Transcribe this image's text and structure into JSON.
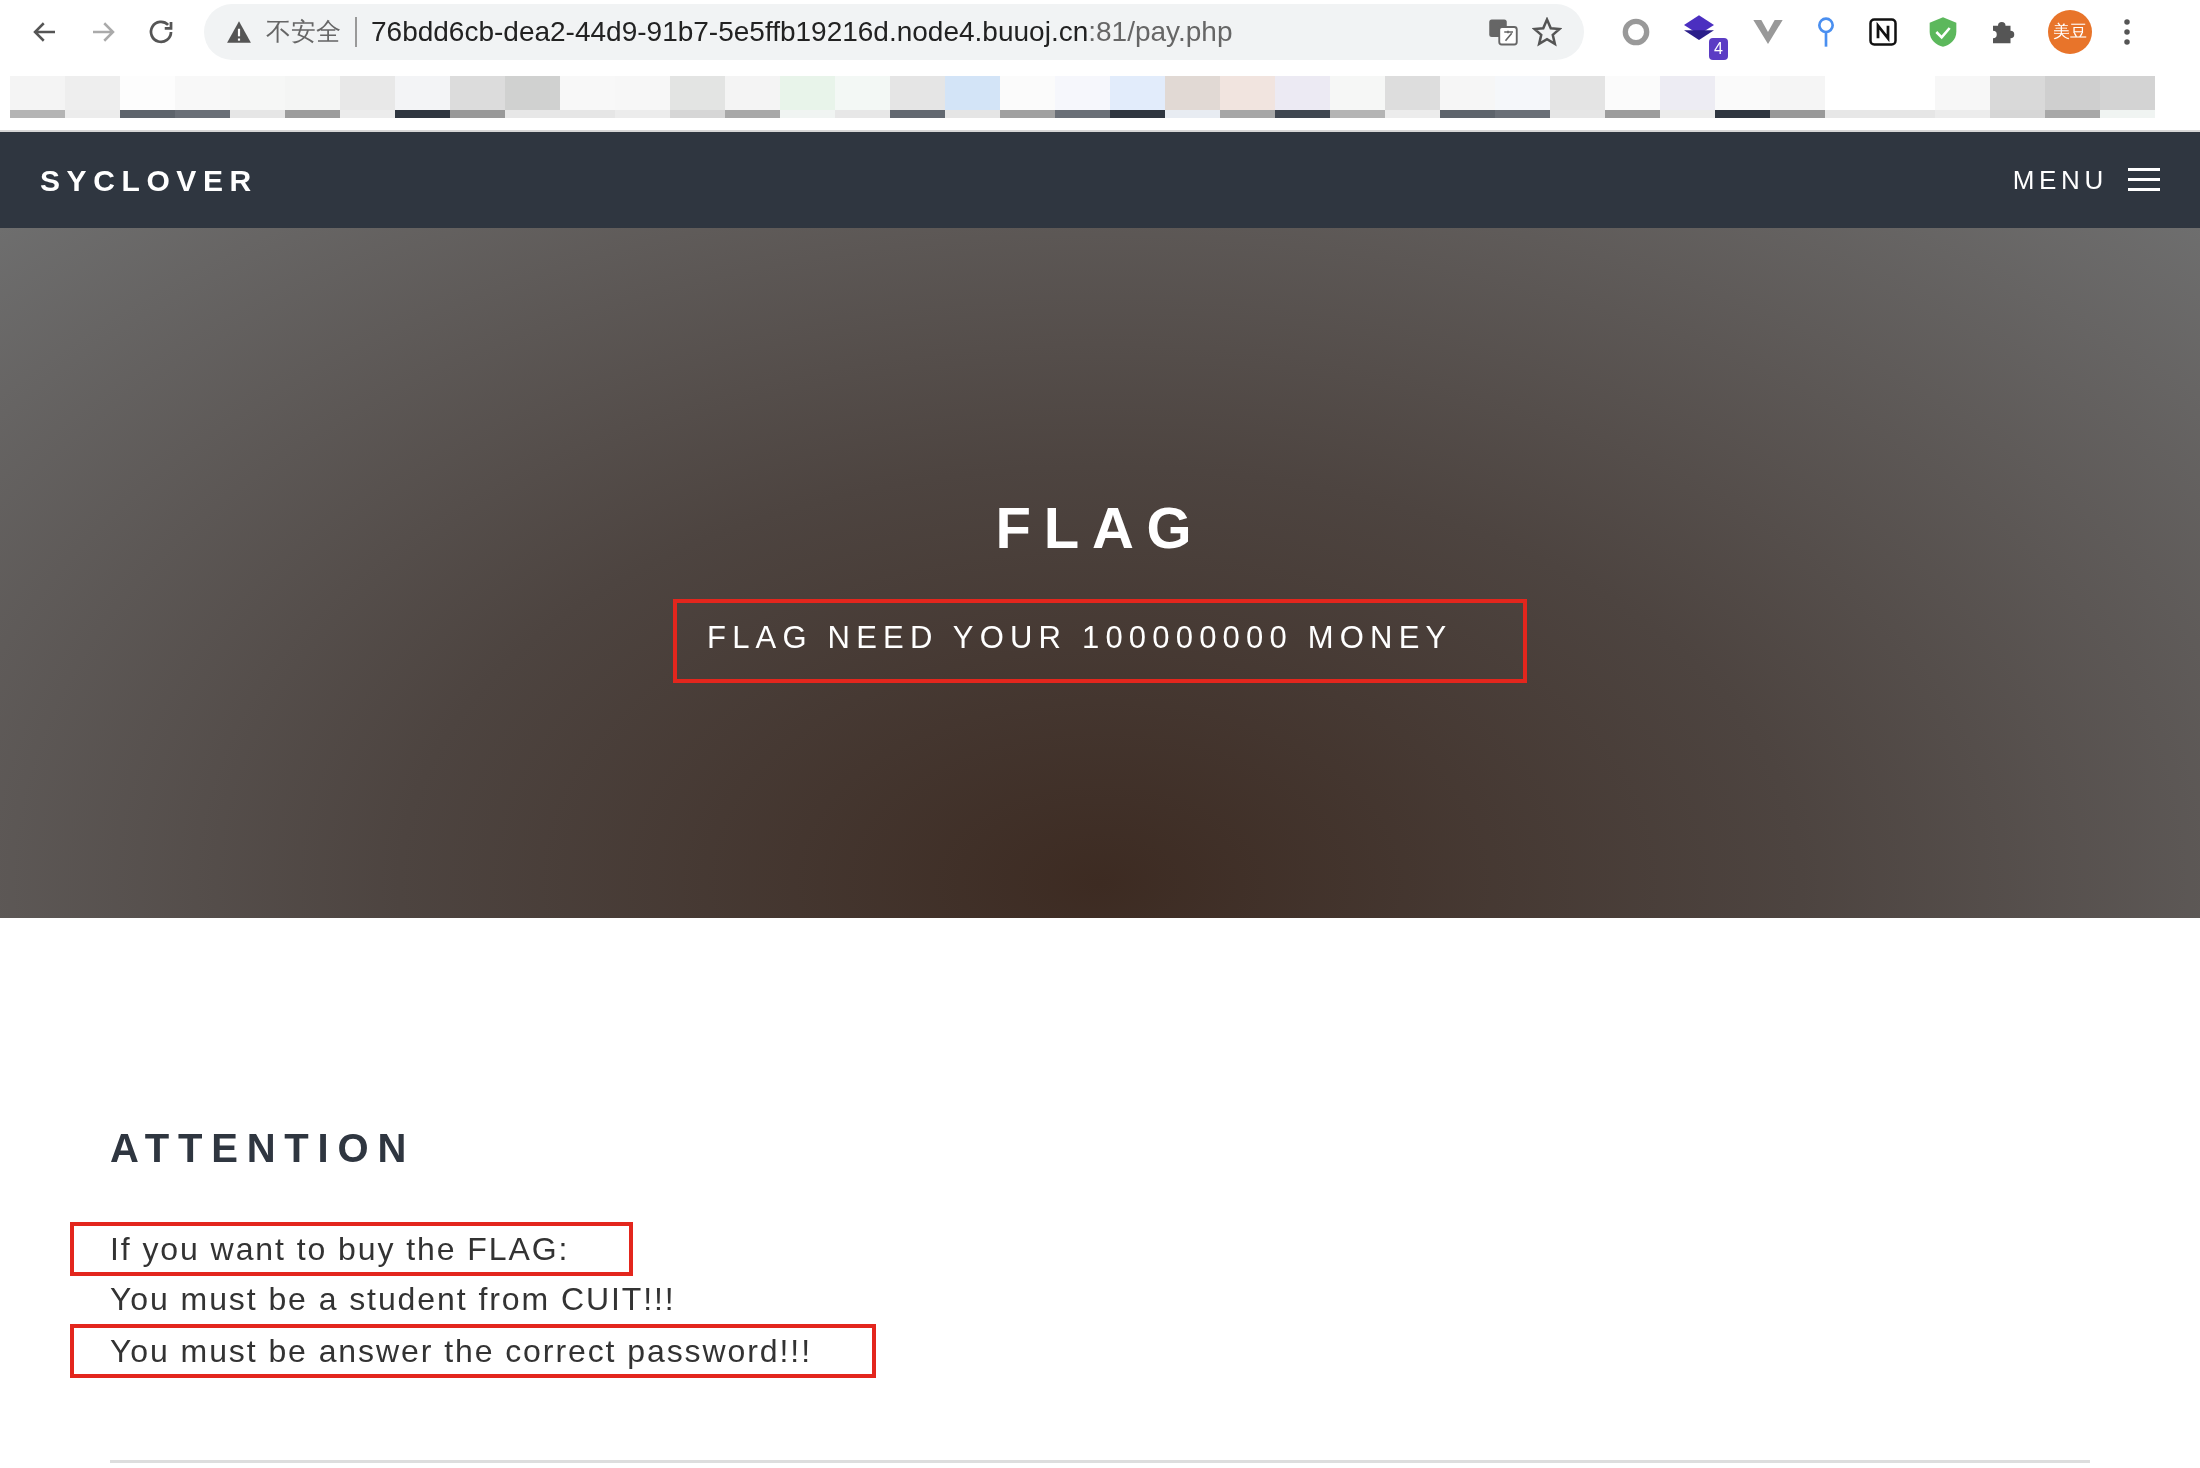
{
  "browser": {
    "security": "不安全",
    "url_host": "76bdd6cb-dea2-44d9-91b7-5e5ffb19216d.node4.buuoj.cn",
    "url_path": ":81/pay.php",
    "extension_badge": "4",
    "profile": "美豆"
  },
  "nav": {
    "brand": "SYCLOVER",
    "menu": "MENU"
  },
  "hero": {
    "title": "FLAG",
    "subtitle": "FLAG NEED YOUR 100000000 MONEY",
    "subtitle_highlighted": true
  },
  "section": {
    "heading": "ATTENTION",
    "lines": [
      {
        "text": "If you want to buy the FLAG:",
        "highlighted": true
      },
      {
        "text": "You must be a student from CUIT!!!",
        "highlighted": false
      },
      {
        "text": "You must be answer the correct password!!!",
        "highlighted": true
      }
    ]
  }
}
